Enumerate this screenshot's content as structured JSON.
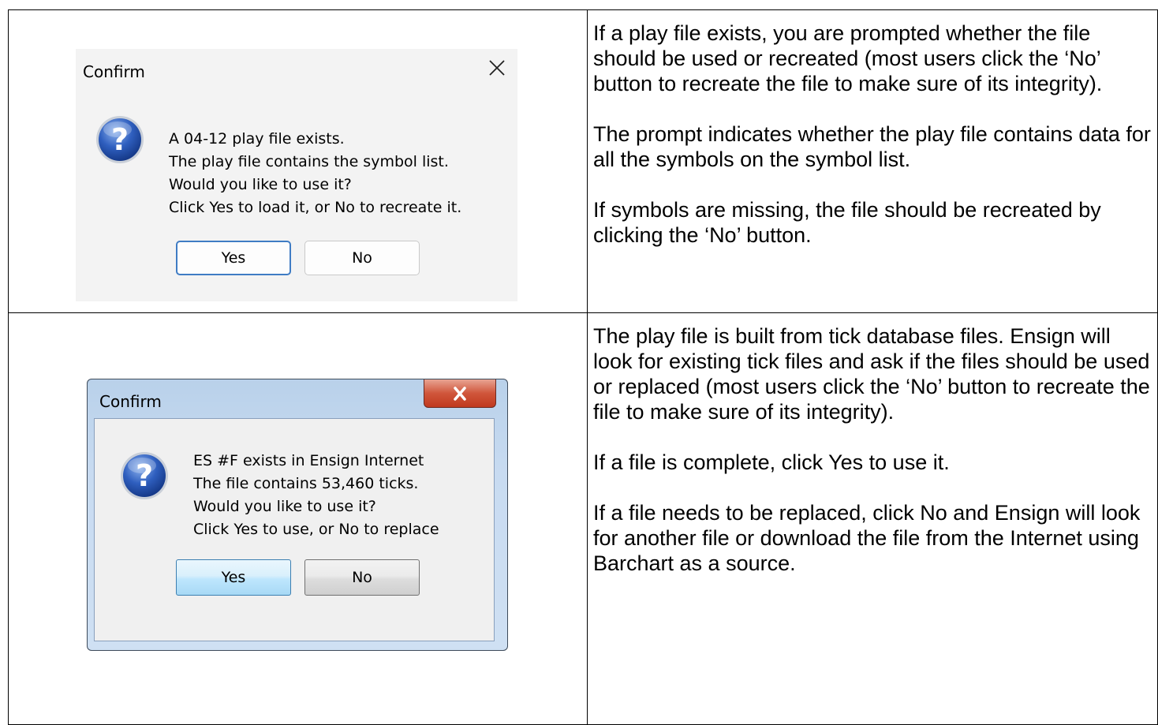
{
  "row1": {
    "dialog": {
      "title": "Confirm",
      "icon": "question-icon",
      "message_lines": [
        "A 04-12 play file exists.",
        "The play file contains the symbol list.",
        "Would you like to use it?",
        "Click Yes to load it, or No to recreate it."
      ],
      "yes_label": "Yes",
      "no_label": "No"
    },
    "paragraphs": [
      "If a play file exists, you are prompted whether the file should be used or recreated (most users click the ‘No’ button to recreate the file to make sure of its integrity).",
      "The prompt indicates whether the play file contains data for all the symbols on the symbol list.",
      "If symbols are missing, the file should be recreated by clicking the ‘No’ button."
    ]
  },
  "row2": {
    "dialog": {
      "title": "Confirm",
      "icon": "question-icon",
      "message_lines": [
        "ES #F exists in Ensign Internet",
        "The file contains 53,460 ticks.",
        "Would you like to use it?",
        "Click Yes to use, or No to replace"
      ],
      "yes_label": "Yes",
      "no_label": "No"
    },
    "paragraphs": [
      "The play file is built from tick database files. Ensign will look for existing tick files and ask if the files should be used or replaced (most users click the ‘No’ button to recreate the file to make sure of its integrity).",
      "If a file is complete, click Yes to use it.",
      "If a file needs to be replaced, click No and Ensign will look for another file or download the file from the Internet using Barchart as a source."
    ]
  }
}
